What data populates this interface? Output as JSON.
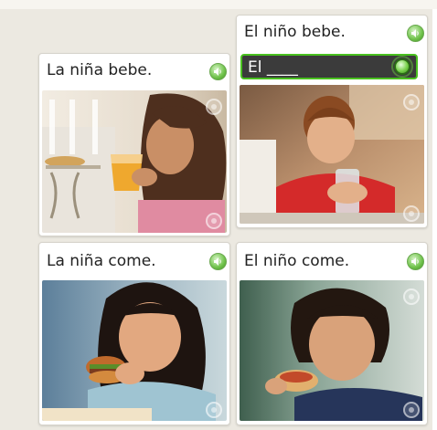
{
  "cards": [
    {
      "caption": "La niña bebe.",
      "photo": "girl drinking orange juice"
    },
    {
      "caption": "El niño bebe.",
      "photo": "boy drinking water"
    },
    {
      "caption": "La niña come.",
      "photo": "girl eating a burger"
    },
    {
      "caption": "El niño come.",
      "photo": "boy eating a sandwich"
    }
  ],
  "answer_input": {
    "value": "El ____"
  },
  "colors": {
    "accent_green": "#49c11f",
    "input_bg": "#3b3b3b",
    "page_bg": "#ece9e1"
  },
  "icons": {
    "audio": "speaker-icon",
    "mic": "microphone-icon",
    "select": "radio-circle-icon"
  }
}
